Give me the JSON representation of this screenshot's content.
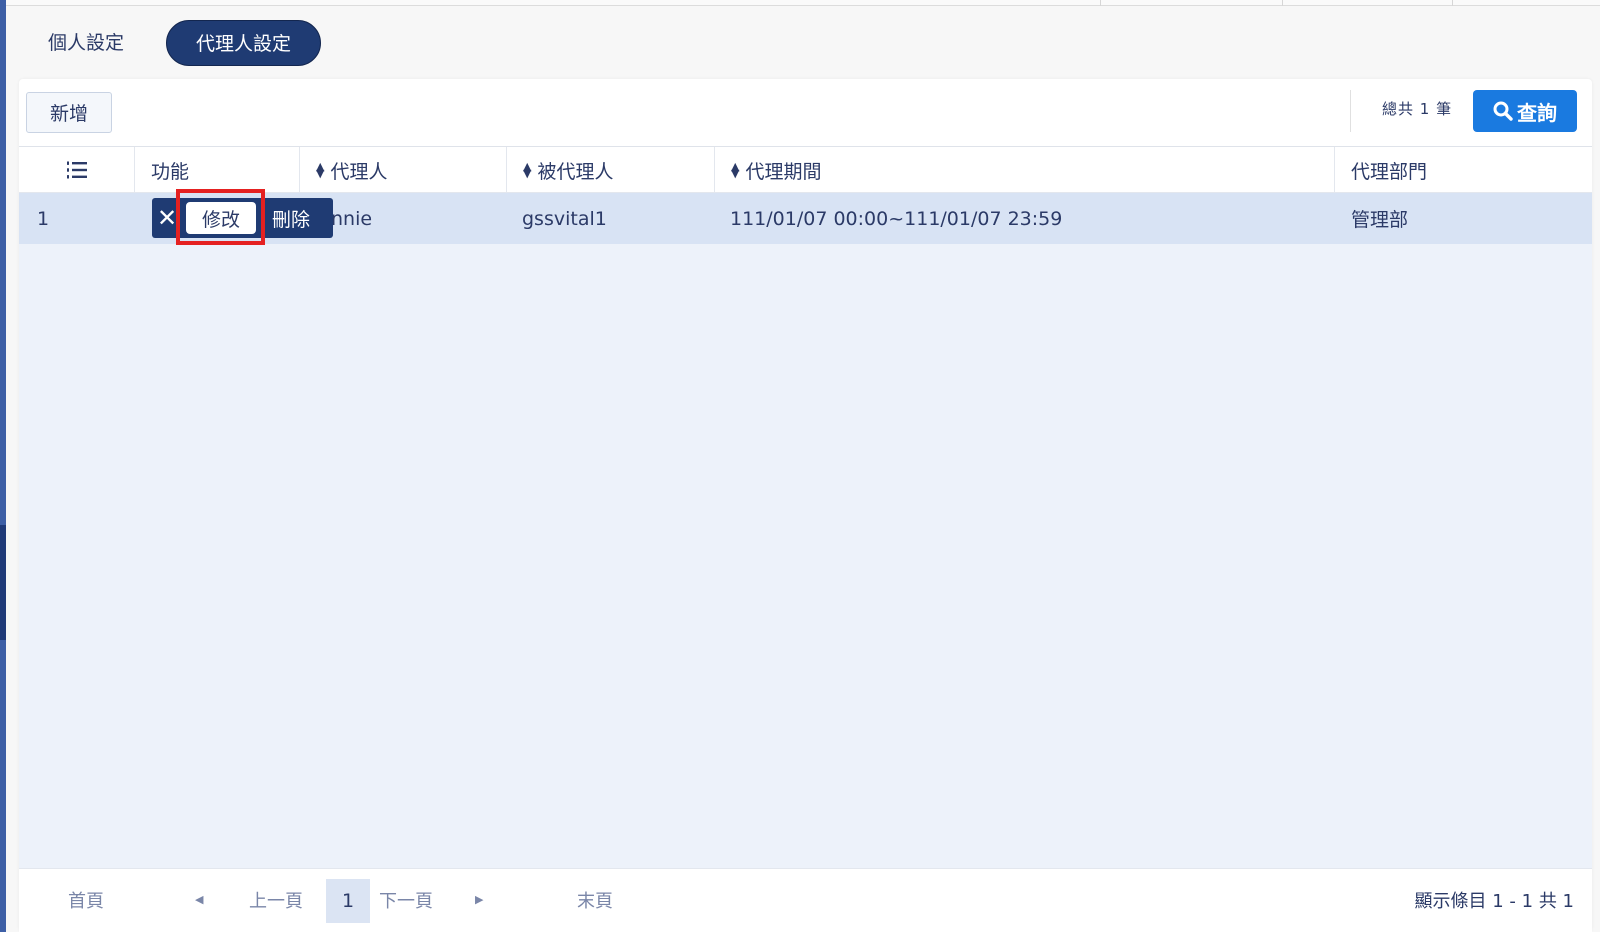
{
  "tabs": [
    {
      "label": "個人設定",
      "active": false
    },
    {
      "label": "代理人設定",
      "active": true
    }
  ],
  "toolbar": {
    "add_label": "新增",
    "total_text": "總共 1 筆",
    "query_label": "查詢",
    "query_icon": "search-icon"
  },
  "table": {
    "columns": [
      {
        "label": "",
        "icon": "list-numbered-icon"
      },
      {
        "label": "功能"
      },
      {
        "label": "代理人",
        "sortable": true
      },
      {
        "label": "被代理人",
        "sortable": true
      },
      {
        "label": "代理期間",
        "sortable": true
      },
      {
        "label": "代理部門"
      }
    ],
    "rows": [
      {
        "num": "1",
        "agent": "nnie",
        "principal": "gssvital1",
        "period": "111/01/07 00:00~111/01/07 23:59",
        "department": "管理部"
      }
    ]
  },
  "row_actions": {
    "close": "✕",
    "edit": "修改",
    "delete": "刪除"
  },
  "pager": {
    "first": "首頁",
    "prev_arrow": "◀",
    "prev": "上一頁",
    "current": "1",
    "next": "下一頁",
    "next_arrow": "▶",
    "last": "末頁",
    "info": "顯示條目 1 - 1 共 1"
  },
  "colors": {
    "accent": "#1f3b73",
    "query": "#1a7ae0",
    "row_selected": "#d8e3f4",
    "highlight": "#e52121"
  }
}
